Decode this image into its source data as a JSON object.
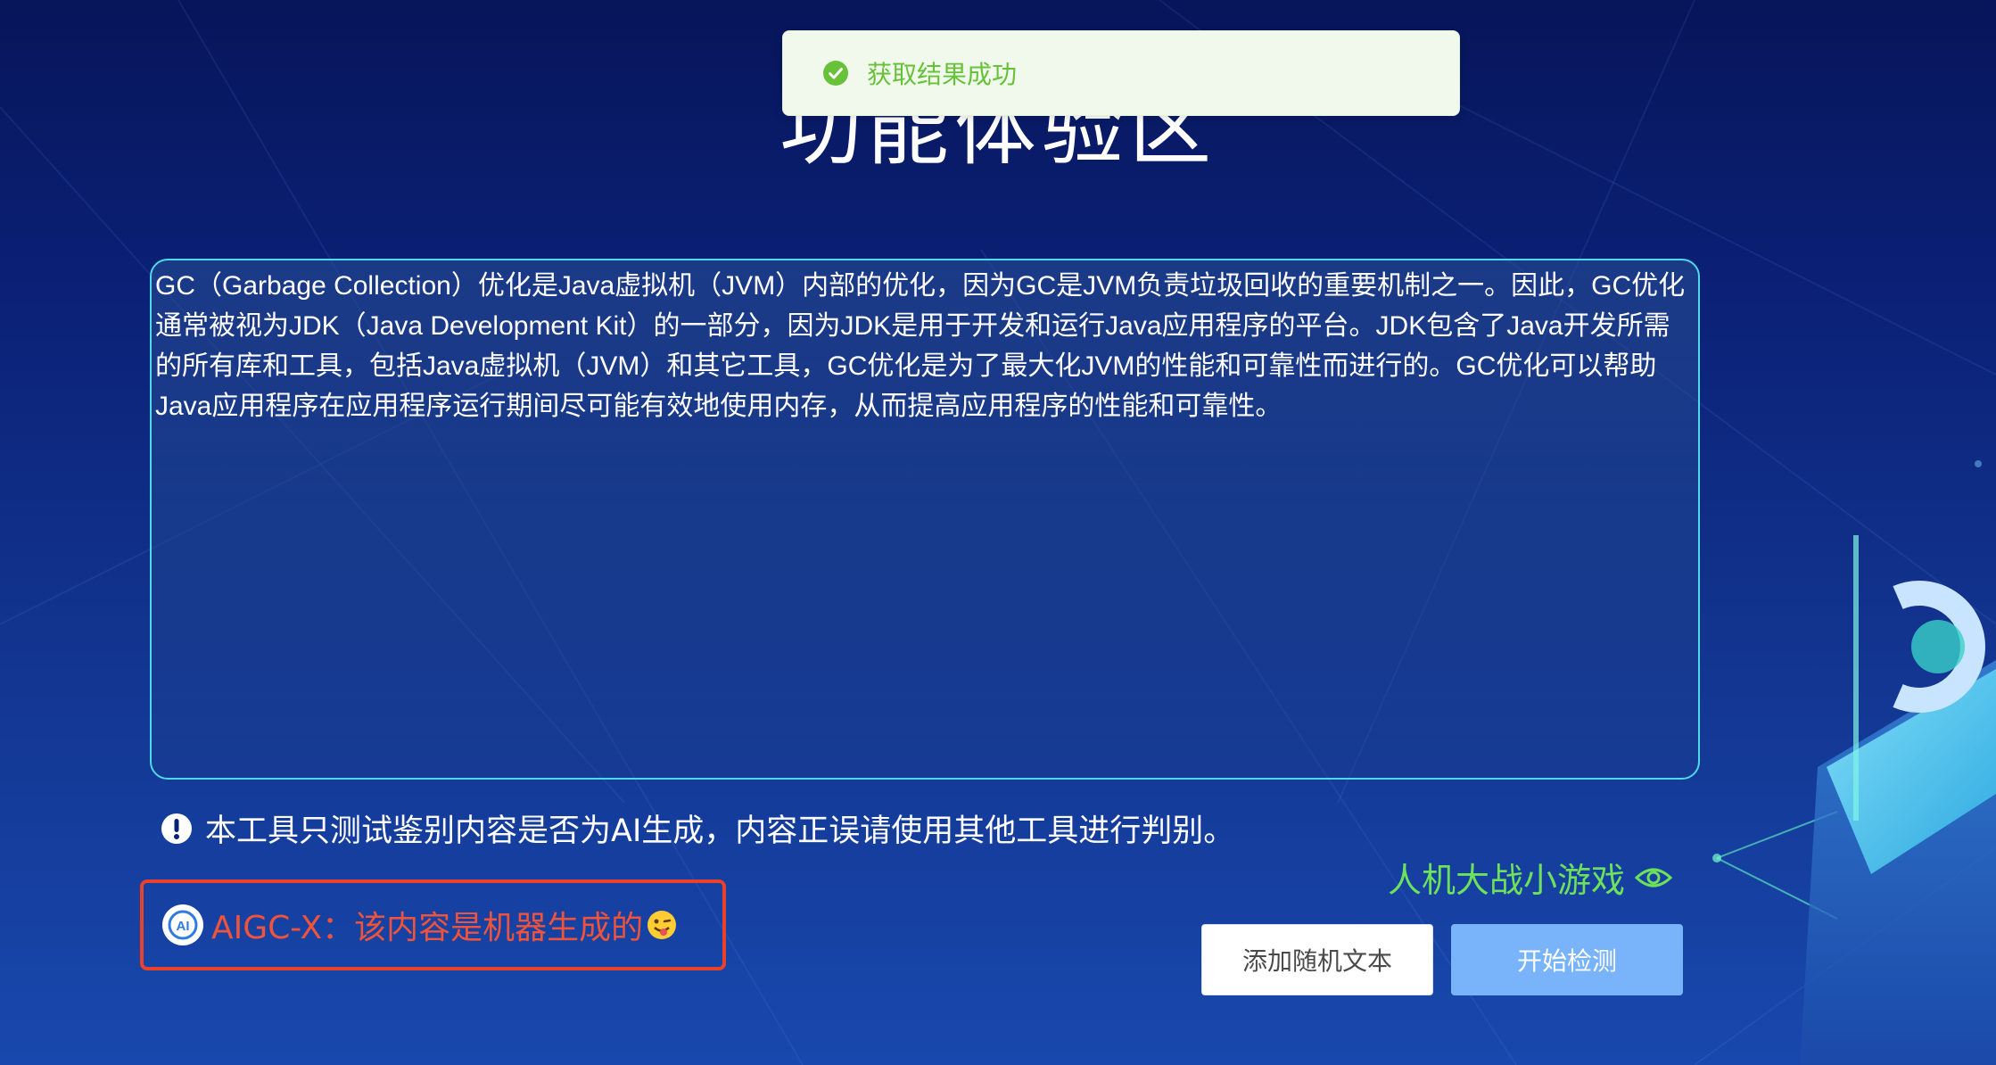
{
  "page_title": "功能体验区",
  "toast": {
    "icon": "check-circle-icon",
    "message": "获取结果成功",
    "color": "#67c23a"
  },
  "input": {
    "text": "GC（Garbage Collection）优化是Java虚拟机（JVM）内部的优化，因为GC是JVM负责垃圾回收的重要机制之一。因此，GC优化通常被视为JDK（Java Development Kit）的一部分，因为JDK是用于开发和运行Java应用程序的平台。JDK包含了Java开发所需的所有库和工具，包括Java虚拟机（JVM）和其它工具，GC优化是为了最大化JVM的性能和可靠性而进行的。GC优化可以帮助Java应用程序在应用程序运行期间尽可能有效地使用内存，从而提高应用程序的性能和可靠性。"
  },
  "notice": {
    "icon": "exclamation-circle-icon",
    "text": "本工具只测试鉴别内容是否为AI生成，内容正误请使用其他工具进行判别。"
  },
  "result": {
    "icon": "aigc-logo-icon",
    "text": "AIGC-X：该内容是机器生成的",
    "emoji": "winking-face-tongue-icon",
    "highlight_color": "#e8412c"
  },
  "game_link": {
    "label": "人机大战小游戏",
    "icon": "eye-icon",
    "color": "#6de05c"
  },
  "buttons": {
    "random_text": "添加随机文本",
    "start_detect": "开始检测"
  }
}
